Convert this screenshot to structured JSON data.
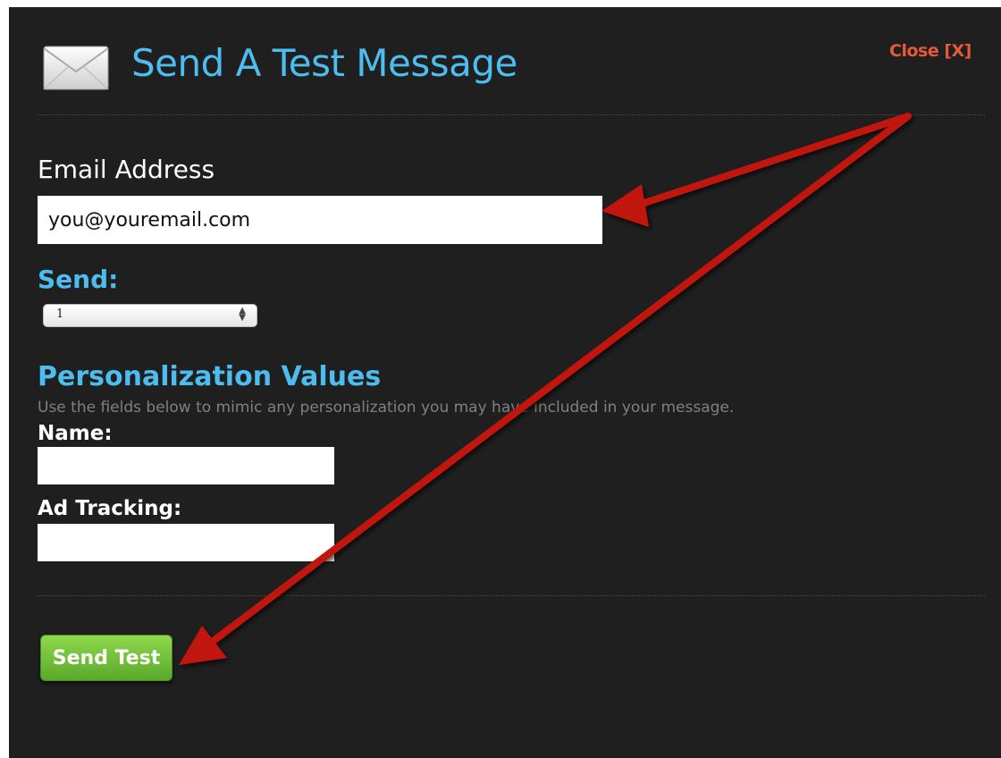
{
  "dialog": {
    "title": "Send A Test Message",
    "close_label": "Close [X]"
  },
  "email": {
    "label": "Email Address",
    "value": "you@youremail.com"
  },
  "send": {
    "label": "Send:",
    "selected": "1"
  },
  "personalization": {
    "heading": "Personalization Values",
    "description": "Use the fields below to mimic any personalization you may have included in your message.",
    "name_label": "Name:",
    "name_value": "",
    "ad_tracking_label": "Ad Tracking:",
    "ad_tracking_value": ""
  },
  "actions": {
    "send_test_label": "Send Test"
  },
  "icons": {
    "envelope": "envelope-icon",
    "select_arrows": "updown-arrows-icon"
  },
  "colors": {
    "background": "#1f1f1f",
    "title": "#4dbdf0",
    "close": "#e8593a",
    "button": "#6fc23a",
    "annotation_arrow": "#c0170e"
  }
}
